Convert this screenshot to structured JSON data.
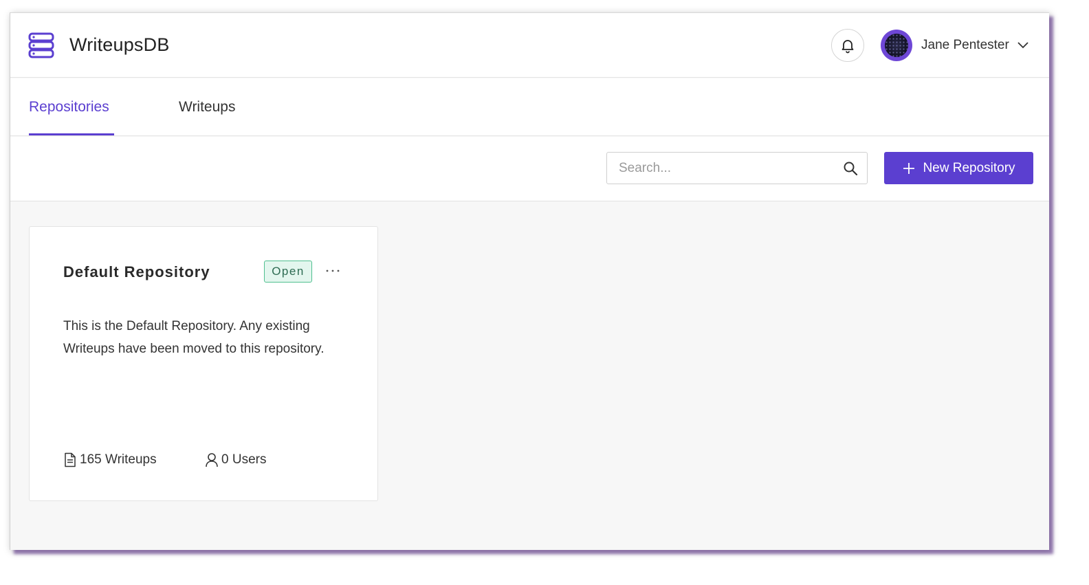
{
  "app": {
    "title": "WriteupsDB",
    "logo_icon": "database-icon",
    "accent_color": "#5b3fd0"
  },
  "header": {
    "notification_icon": "bell-icon",
    "user_name": "Jane Pentester",
    "user_menu_icon": "chevron-down-icon"
  },
  "tabs": [
    {
      "label": "Repositories",
      "active": true
    },
    {
      "label": "Writeups",
      "active": false
    }
  ],
  "toolbar": {
    "search_placeholder": "Search...",
    "search_value": "",
    "new_button_label": "New Repository"
  },
  "repositories": [
    {
      "name": "Default Repository",
      "status": "Open",
      "status_color": "#4fbf8f",
      "description": "This is the Default Repository. Any existing Writeups have been moved to this repository.",
      "writeups_count": "165 Writeups",
      "users_count": "0 Users"
    }
  ]
}
